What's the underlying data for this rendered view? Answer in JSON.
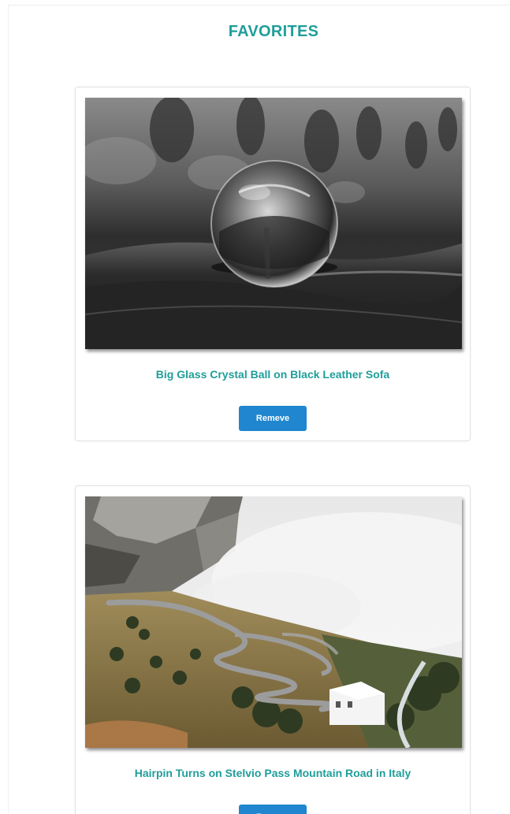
{
  "page": {
    "title": "FAVORITES"
  },
  "favorites": [
    {
      "title": "Big Glass Crystal Ball on Black Leather Sofa",
      "remove_label": "Remeve",
      "image_alt": "Big Glass Crystal Ball on Black Leather Sofa"
    },
    {
      "title": "Hairpin Turns on Stelvio Pass Mountain Road in Italy",
      "remove_label": "Remeve",
      "image_alt": "Hairpin Turns on Stelvio Pass Mountain Road in Italy"
    }
  ],
  "colors": {
    "accent_teal": "#1f9e9a",
    "button_blue": "#1f86cf",
    "card_border": "#e2e2e2"
  }
}
